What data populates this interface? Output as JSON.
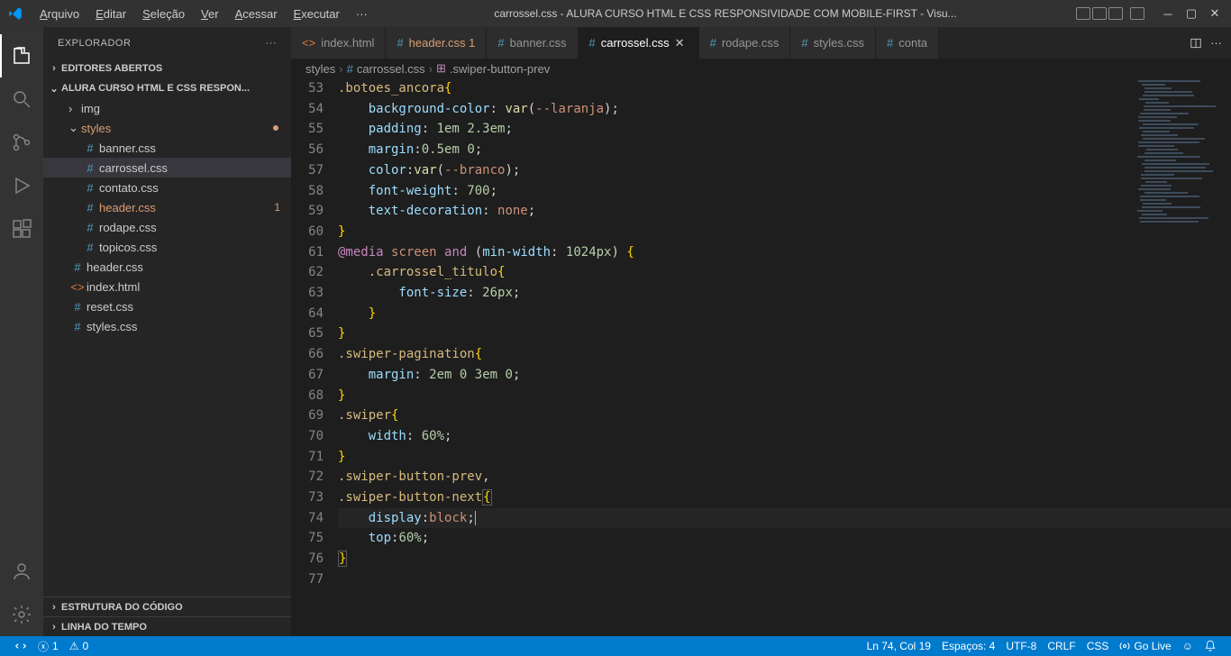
{
  "window_title": "carrossel.css - ALURA CURSO HTML E CSS RESPONSIVIDADE COM MOBILE-FIRST - Visu...",
  "menu": [
    "Arquivo",
    "Editar",
    "Seleção",
    "Ver",
    "Acessar",
    "Executar",
    "···"
  ],
  "sidebar": {
    "title": "EXPLORADOR",
    "sections": {
      "open_editors": "EDITORES ABERTOS",
      "folder": "ALURA CURSO HTML E CSS RESPON...",
      "outline": "ESTRUTURA DO CÓDIGO",
      "timeline": "LINHA DO TEMPO"
    },
    "tree": {
      "img": "img",
      "styles": "styles",
      "styles_items": [
        {
          "name": "banner.css",
          "icon": "#"
        },
        {
          "name": "carrossel.css",
          "icon": "#",
          "active": true
        },
        {
          "name": "contato.css",
          "icon": "#"
        },
        {
          "name": "header.css",
          "icon": "#",
          "mod": true,
          "badge": "1"
        },
        {
          "name": "rodape.css",
          "icon": "#"
        },
        {
          "name": "topicos.css",
          "icon": "#"
        }
      ],
      "root_items": [
        {
          "name": "header.css",
          "icon": "#"
        },
        {
          "name": "index.html",
          "icon": "<>"
        },
        {
          "name": "reset.css",
          "icon": "#"
        },
        {
          "name": "styles.css",
          "icon": "#"
        }
      ]
    }
  },
  "tabs": [
    {
      "icon": "<>",
      "name": "index.html"
    },
    {
      "icon": "#",
      "name": "header.css",
      "mod": true,
      "badge": "1"
    },
    {
      "icon": "#",
      "name": "banner.css"
    },
    {
      "icon": "#",
      "name": "carrossel.css",
      "active": true,
      "close": true
    },
    {
      "icon": "#",
      "name": "rodape.css"
    },
    {
      "icon": "#",
      "name": "styles.css"
    },
    {
      "icon": "#",
      "name": "conta"
    }
  ],
  "breadcrumbs": [
    "styles",
    "carrossel.css",
    ".swiper-button-prev"
  ],
  "code_start": 53,
  "code_lines": [
    {
      "t": [
        [
          "sel",
          ".botoes_ancora"
        ],
        [
          "brace",
          "{"
        ]
      ]
    },
    {
      "t": [
        [
          "prop",
          "    background-color"
        ],
        [
          "punc",
          ": "
        ],
        [
          "fn",
          "var"
        ],
        [
          "punc",
          "("
        ],
        [
          "val",
          "--laranja"
        ],
        [
          "punc",
          ");"
        ]
      ]
    },
    {
      "t": [
        [
          "prop",
          "    padding"
        ],
        [
          "punc",
          ": "
        ],
        [
          "num",
          "1em"
        ],
        [
          "punc",
          " "
        ],
        [
          "num",
          "2.3em"
        ],
        [
          "punc",
          ";"
        ]
      ]
    },
    {
      "t": [
        [
          "prop",
          "    margin"
        ],
        [
          "punc",
          ":"
        ],
        [
          "num",
          "0.5em"
        ],
        [
          "punc",
          " "
        ],
        [
          "num",
          "0"
        ],
        [
          "punc",
          ";"
        ]
      ]
    },
    {
      "t": [
        [
          "prop",
          "    color"
        ],
        [
          "punc",
          ":"
        ],
        [
          "fn",
          "var"
        ],
        [
          "punc",
          "("
        ],
        [
          "val",
          "--branco"
        ],
        [
          "punc",
          ");"
        ]
      ]
    },
    {
      "t": [
        [
          "prop",
          "    font-weight"
        ],
        [
          "punc",
          ": "
        ],
        [
          "num",
          "700"
        ],
        [
          "punc",
          ";"
        ]
      ]
    },
    {
      "t": [
        [
          "prop",
          "    text-decoration"
        ],
        [
          "punc",
          ": "
        ],
        [
          "val",
          "none"
        ],
        [
          "punc",
          ";"
        ]
      ]
    },
    {
      "t": [
        [
          "brace",
          "}"
        ]
      ]
    },
    {
      "t": [
        [
          "kw",
          "@media"
        ],
        [
          "punc",
          " "
        ],
        [
          "val",
          "screen"
        ],
        [
          "punc",
          " "
        ],
        [
          "kw",
          "and"
        ],
        [
          "punc",
          " ("
        ],
        [
          "prop",
          "min-width"
        ],
        [
          "punc",
          ": "
        ],
        [
          "num",
          "1024px"
        ],
        [
          "punc",
          ") "
        ],
        [
          "brace",
          "{"
        ]
      ]
    },
    {
      "t": [
        [
          "sel",
          "    .carrossel_titulo"
        ],
        [
          "brace",
          "{"
        ]
      ]
    },
    {
      "t": [
        [
          "prop",
          "        font-size"
        ],
        [
          "punc",
          ": "
        ],
        [
          "num",
          "26px"
        ],
        [
          "punc",
          ";"
        ]
      ]
    },
    {
      "t": [
        [
          "brace",
          "    }"
        ]
      ]
    },
    {
      "t": [
        [
          "brace",
          "}"
        ]
      ]
    },
    {
      "t": [
        [
          "sel",
          ".swiper-pagination"
        ],
        [
          "brace",
          "{"
        ]
      ]
    },
    {
      "t": [
        [
          "prop",
          "    margin"
        ],
        [
          "punc",
          ": "
        ],
        [
          "num",
          "2em"
        ],
        [
          "punc",
          " "
        ],
        [
          "num",
          "0"
        ],
        [
          "punc",
          " "
        ],
        [
          "num",
          "3em"
        ],
        [
          "punc",
          " "
        ],
        [
          "num",
          "0"
        ],
        [
          "punc",
          ";"
        ]
      ]
    },
    {
      "t": [
        [
          "brace",
          "}"
        ]
      ]
    },
    {
      "t": [
        [
          "sel",
          ".swiper"
        ],
        [
          "brace",
          "{"
        ]
      ]
    },
    {
      "t": [
        [
          "prop",
          "    width"
        ],
        [
          "punc",
          ": "
        ],
        [
          "num",
          "60%"
        ],
        [
          "punc",
          ";"
        ]
      ]
    },
    {
      "t": [
        [
          "brace",
          "}"
        ]
      ]
    },
    {
      "t": [
        [
          "sel",
          ".swiper-button-prev"
        ],
        [
          "punc",
          ","
        ]
      ]
    },
    {
      "t": [
        [
          "sel",
          ".swiper-button-next"
        ],
        [
          "brace",
          "{"
        ]
      ],
      "box": true
    },
    {
      "t": [
        [
          "prop",
          "    display"
        ],
        [
          "punc",
          ":"
        ],
        [
          "val",
          "block"
        ],
        [
          "punc",
          ";"
        ]
      ],
      "hl": true,
      "cursor": true
    },
    {
      "t": [
        [
          "prop",
          "    top"
        ],
        [
          "punc",
          ":"
        ],
        [
          "num",
          "60%"
        ],
        [
          "punc",
          ";"
        ]
      ]
    },
    {
      "t": [
        [
          "brace",
          "}"
        ]
      ],
      "box": true
    },
    {
      "t": []
    }
  ],
  "status": {
    "errors": "1",
    "warnings": "0",
    "pos": "Ln 74, Col 19",
    "spaces": "Espaços: 4",
    "encoding": "UTF-8",
    "eol": "CRLF",
    "lang": "CSS",
    "golive": "Go Live"
  }
}
